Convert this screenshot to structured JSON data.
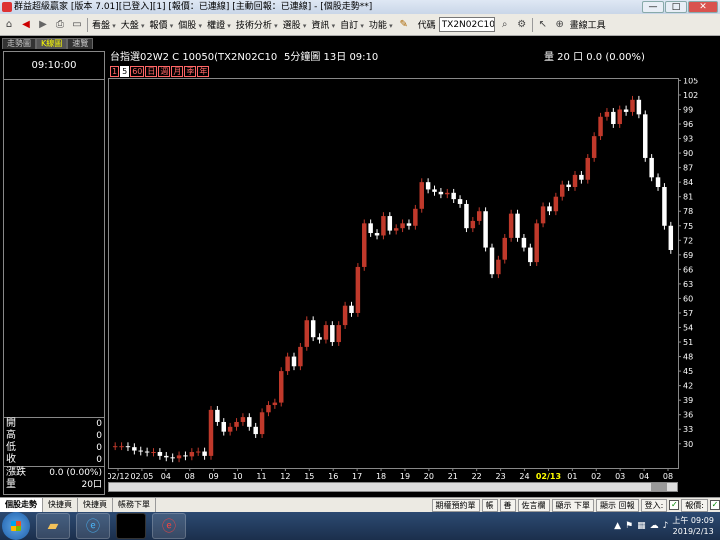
{
  "window": {
    "title": "群益超級贏家 [版本 7.01][已登入][1] [報價：已連線] [主動回報：已連線] - [個股走勢**]",
    "buttons": [
      "—",
      "□",
      "✕"
    ]
  },
  "toolbar": {
    "menus": [
      "看盤",
      "大盤",
      "報價",
      "個股",
      "權證",
      "技術分析",
      "選股",
      "資訊",
      "自訂",
      "功能"
    ],
    "code_label": "代碼",
    "code_value": "TX2N02C10(",
    "chart_tool": "畫線工具"
  },
  "tabs": [
    "走勢圖",
    "K線圖",
    "速覽"
  ],
  "left_panel": {
    "time": "09:10:00",
    "stats": [
      {
        "k": "開",
        "v": "0"
      },
      {
        "k": "高",
        "v": "0"
      },
      {
        "k": "低",
        "v": "0"
      },
      {
        "k": "收",
        "v": "0"
      }
    ],
    "change_label": "漲跌",
    "change_value": "0.0 (0.00%)",
    "volume_label": "量",
    "volume_value": "20口"
  },
  "chart_header": {
    "name": "台指選02W2 C 10050(TX2N02C10",
    "interval": "5分鐘圖 13日 09:10",
    "volume": "量 20 口 0.0 (0.00%)"
  },
  "periods": [
    "1",
    "5",
    "60",
    "日",
    "週",
    "月",
    "季",
    "年"
  ],
  "chart_data": {
    "type": "candlestick",
    "x_labels": [
      "02/12",
      "02.05",
      "04",
      "08",
      "09",
      "10",
      "11",
      "12",
      "15",
      "16",
      "17",
      "18",
      "19",
      "20",
      "21",
      "22",
      "23",
      "24",
      "02/13",
      "01",
      "02",
      "03",
      "04",
      "08"
    ],
    "y_ticks": [
      105,
      102,
      99,
      96,
      93,
      90,
      87,
      84,
      81,
      78,
      75,
      72,
      69,
      66,
      63,
      60,
      57,
      54,
      51,
      48,
      45,
      42,
      39,
      36,
      33,
      30
    ],
    "ylim": [
      25,
      105.5
    ],
    "closes": [
      29.5,
      29.5,
      29.3,
      28.6,
      28.4,
      28.2,
      28.3,
      27.5,
      27.2,
      27.0,
      27.6,
      27.4,
      28.3,
      28.4,
      27.5,
      37.0,
      34.5,
      32.5,
      33.5,
      34.5,
      35.5,
      33.5,
      32.0,
      36.5,
      38.0,
      38.5,
      45.0,
      48.0,
      46.0,
      50.0,
      55.5,
      52.0,
      51.5,
      54.5,
      51.0,
      54.5,
      58.5,
      57.0,
      66.5,
      75.5,
      73.5,
      73.0,
      77.0,
      74.0,
      74.5,
      75.5,
      75.0,
      78.5,
      84.0,
      82.5,
      82.0,
      81.5,
      81.8,
      80.5,
      79.5,
      74.5,
      76.0,
      78.0,
      70.5,
      65.0,
      68.0,
      72.5,
      77.5,
      72.5,
      70.5,
      67.5,
      75.5,
      79.0,
      78.0,
      81.0,
      83.5,
      83.0,
      85.5,
      84.5,
      89.0,
      93.5,
      97.5,
      98.5,
      96.0,
      99.0,
      98.5,
      101.0,
      98.0,
      89.0,
      85.0,
      83.0,
      75.0,
      70.0
    ]
  },
  "bottom_tabs": [
    "個股走勢",
    "快捷頁",
    "快捷頁",
    "帳務下單"
  ],
  "bottom_buttons": [
    "期權預約單",
    "帳",
    "善",
    "佐言欄",
    "顯示 下單",
    "顯示 回報",
    "登入:",
    "報價:"
  ],
  "taskbar": {
    "time": "上午 09:09",
    "date": "2019/2/13"
  }
}
